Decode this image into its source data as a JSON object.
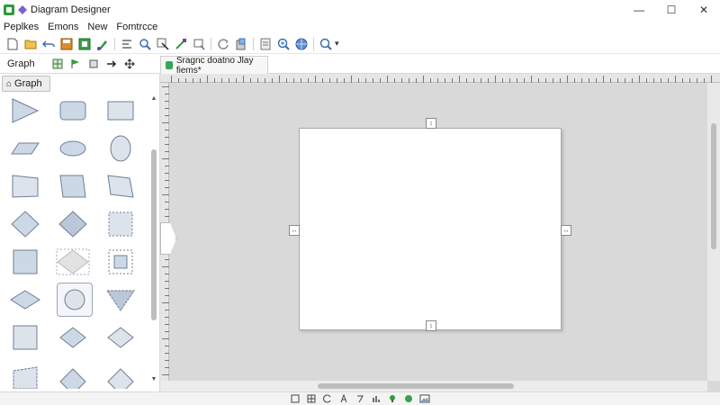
{
  "window": {
    "title": "Diagram Designer",
    "controls": {
      "minimize": "—",
      "maximize": "☐",
      "close": "✕"
    }
  },
  "menu": {
    "items": [
      "Peplkes",
      "Emons",
      "New",
      "Fomtrcce"
    ]
  },
  "toolbar": {
    "buttons": [
      "new-file-icon",
      "open-folder-icon",
      "undo-icon",
      "save-icon",
      "save-all-icon",
      "paint-icon",
      "align-icon",
      "search-icon",
      "select-arrow-icon",
      "link-icon",
      "crop-icon",
      "refresh-icon",
      "clipboard-icon",
      "page-icon",
      "zoom-in-icon",
      "globe-icon",
      "zoom-dropdown-icon"
    ],
    "zoom_caret": "▾"
  },
  "left_panel": {
    "title": "Graph",
    "buttons": [
      "grid-icon",
      "flag-icon",
      "stack-icon",
      "arrow-right-icon",
      "move-icon"
    ],
    "tab_label": "Graph"
  },
  "document_tab": {
    "label": "Sragnc doatno Jlay fiems*"
  },
  "palette_shapes": [
    "triangle-right",
    "rounded-rect",
    "rectangle",
    "parallelogram",
    "ellipse",
    "oval-vertical",
    "trapezoid-left",
    "trapezoid",
    "trapezoid-right",
    "diamond",
    "diamond-shaded",
    "dashed-square",
    "square-shaded",
    "diamond-wide",
    "dashed-square-small",
    "diamond-flat",
    "circle-selected",
    "triangle-down",
    "square",
    "diamond-small",
    "diamond-small-2",
    "pentagon-partial",
    "diamond-partial",
    "diamond-partial-2"
  ],
  "status_bar": {
    "buttons": [
      "page-icon",
      "table-icon",
      "rotate-icon",
      "text-icon",
      "line-icon",
      "chart-icon",
      "tree-icon",
      "layer-icon",
      "image-icon"
    ]
  },
  "colors": {
    "canvas_bg": "#d9d9d9",
    "page_bg": "#ffffff",
    "shape_fill": "#cdd8e6",
    "shape_stroke": "#6e7f96",
    "accent_green": "#2e9c3c"
  }
}
